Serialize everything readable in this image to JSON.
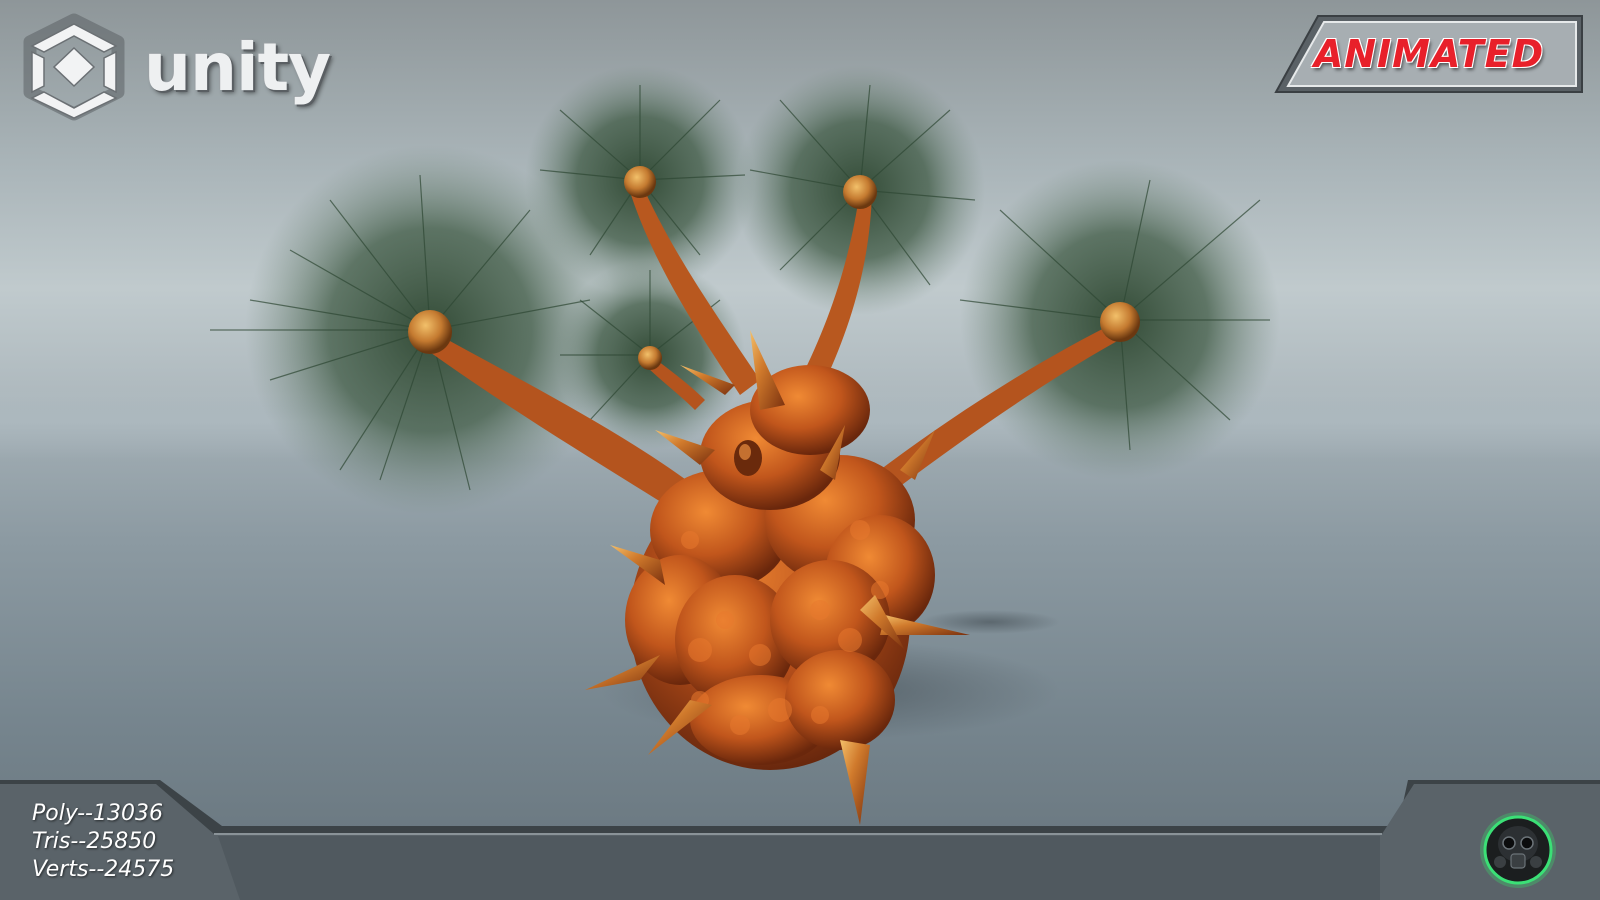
{
  "logo": {
    "icon": "unity-cube-icon",
    "wordmark": "unity"
  },
  "badge": {
    "label": "ANIMATED",
    "color": "#e8202a"
  },
  "stats": {
    "poly": "Poly--13036",
    "tris": "Tris--25850",
    "verts": "Verts--24575"
  },
  "studio_logo": {
    "icon": "gas-mask-icon",
    "glow_color": "#39d36b"
  },
  "model": {
    "body_color": "#c0521a",
    "fur_color": "#3f5a44"
  }
}
